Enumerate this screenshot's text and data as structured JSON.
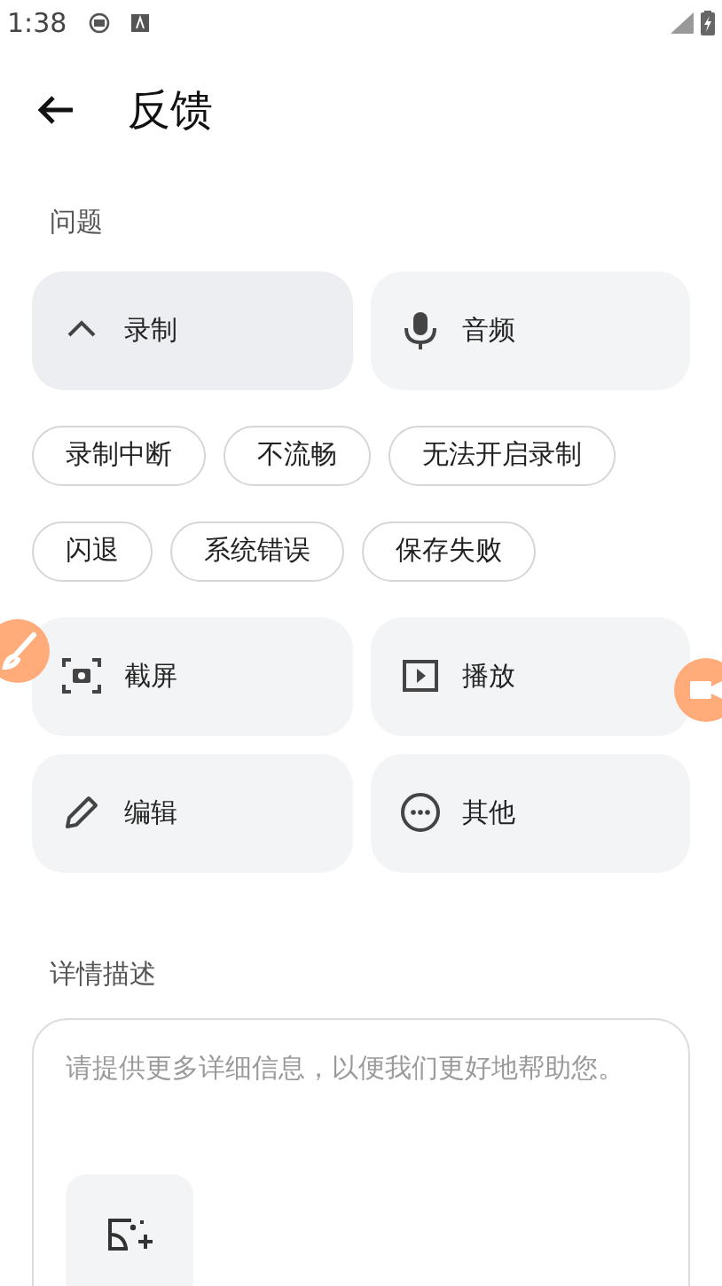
{
  "status_bar": {
    "time": "1:38"
  },
  "header": {
    "title": "反馈"
  },
  "problem_section": {
    "label": "问题"
  },
  "categories": [
    {
      "label": "录制",
      "expanded": true,
      "options": [
        "录制中断",
        "不流畅",
        "无法开启录制",
        "闪退",
        "系统错误",
        "保存失败"
      ]
    },
    {
      "label": "音频",
      "expanded": false
    },
    {
      "label": "截屏",
      "expanded": false
    },
    {
      "label": "播放",
      "expanded": false
    },
    {
      "label": "编辑",
      "expanded": false
    },
    {
      "label": "其他",
      "expanded": false
    }
  ],
  "details_section": {
    "label": "详情描述",
    "placeholder": "请提供更多详细信息，以便我们更好地帮助您。"
  }
}
